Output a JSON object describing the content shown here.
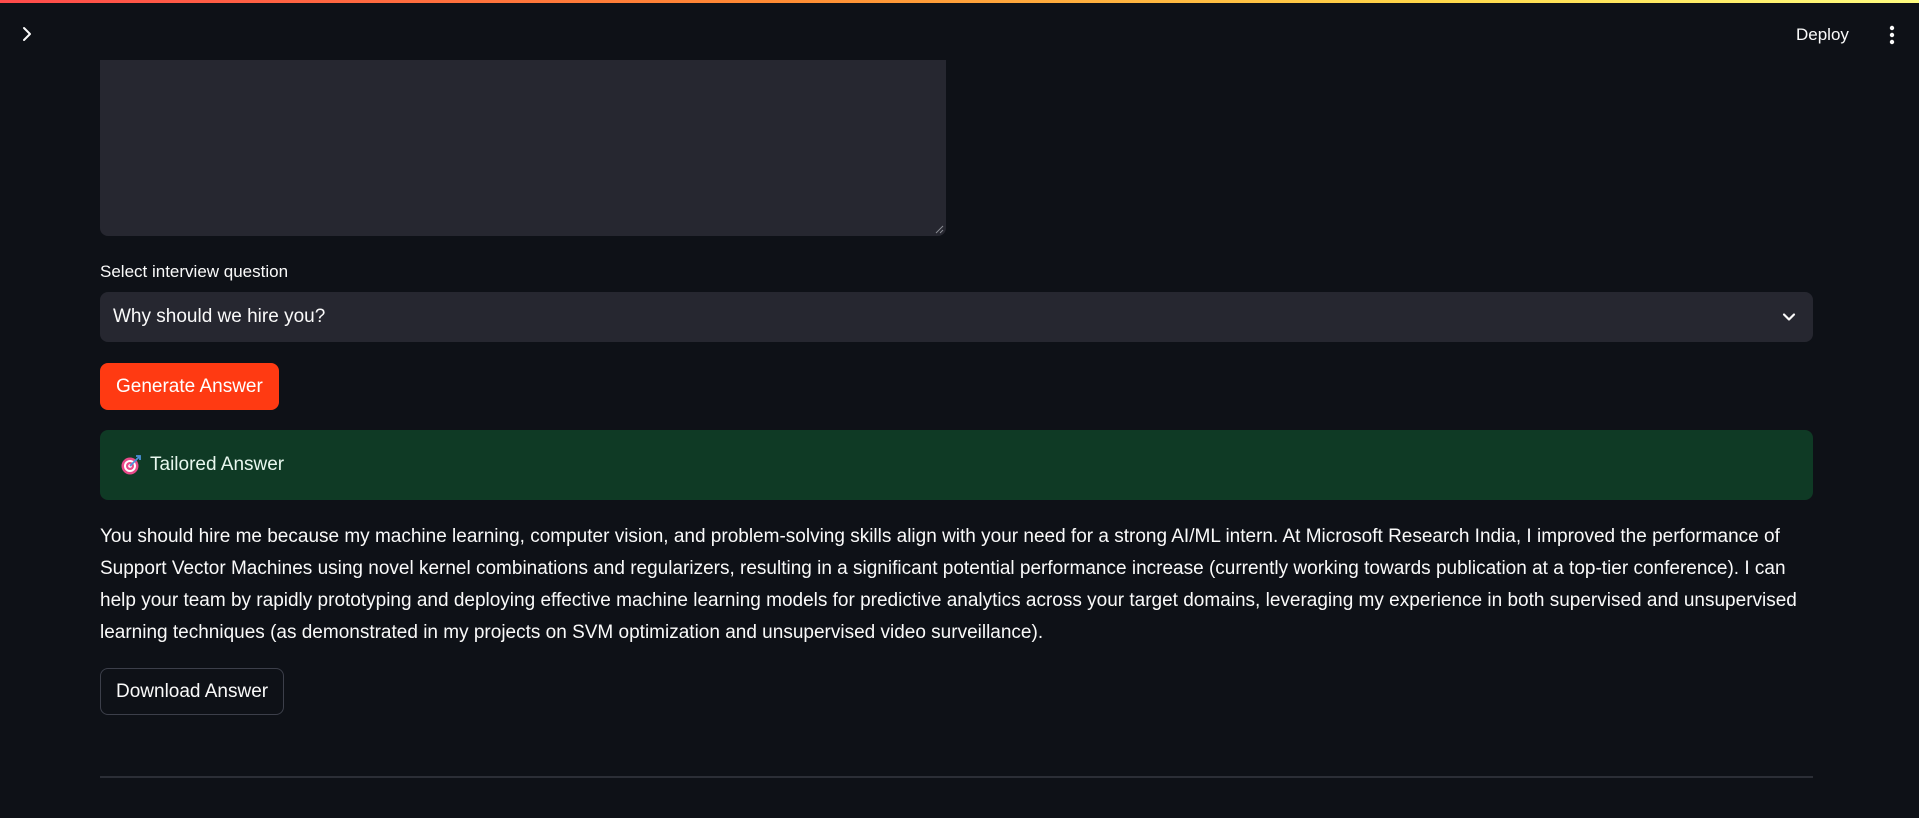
{
  "header": {
    "deploy_label": "Deploy",
    "sidebar_toggle_icon": "chevron-right-icon",
    "menu_icon": "vertical-dots-icon"
  },
  "form": {
    "textarea_value": "",
    "question_label": "Select interview question",
    "question_selected": "Why should we hire you?",
    "generate_label": "Generate Answer"
  },
  "result": {
    "success_icon": "target-icon",
    "success_title": "Tailored Answer",
    "answer_text": "You should hire me because my machine learning, computer vision, and problem-solving skills align with your need for a strong AI/ML intern. At Microsoft Research India, I improved the performance of Support Vector Machines using novel kernel combinations and regularizers, resulting in a significant potential performance increase (currently working towards publication at a top-tier conference). I can help your team by rapidly prototyping and deploying effective machine learning models for predictive analytics across your target domains, leveraging my experience in both supervised and unsupervised learning techniques (as demonstrated in my projects on SVM optimization and unsupervised video surveillance).",
    "download_label": "Download Answer"
  },
  "colors": {
    "background": "#0e1117",
    "input_bg": "#262730",
    "primary": "#ff3a12",
    "success_bg": "#0f3a25"
  }
}
